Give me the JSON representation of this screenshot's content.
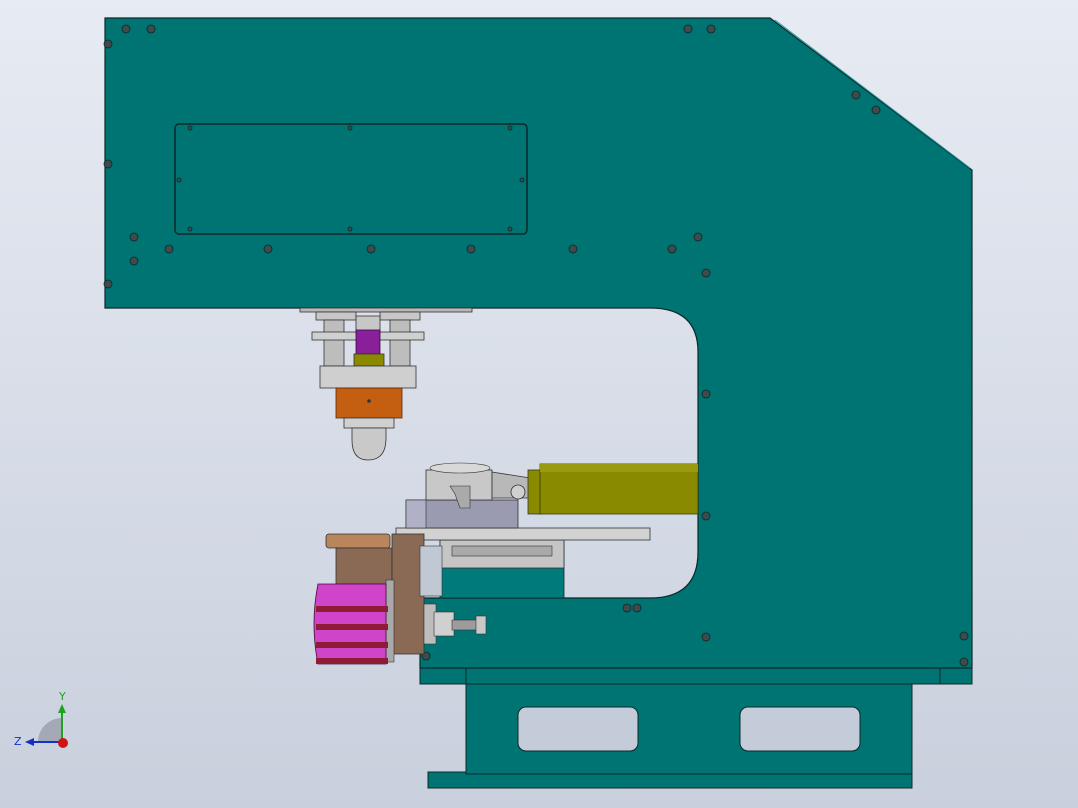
{
  "colors": {
    "body": "#007373",
    "body_dark": "#005f5f",
    "outline": "#0a2a2a",
    "steel": "#c7c7c7",
    "steel_dark": "#8c8c8c",
    "purple": "#8a1f9a",
    "orange": "#c45f12",
    "olive": "#8a8a00",
    "magenta": "#cf44c8",
    "maroon": "#8e1c36",
    "brown": "#8a6a55",
    "axis_y": "#21a121",
    "axis_z": "#1530c8",
    "axis_origin": "#d01414"
  },
  "triad": {
    "y_label": "Y",
    "z_label": "Z"
  }
}
